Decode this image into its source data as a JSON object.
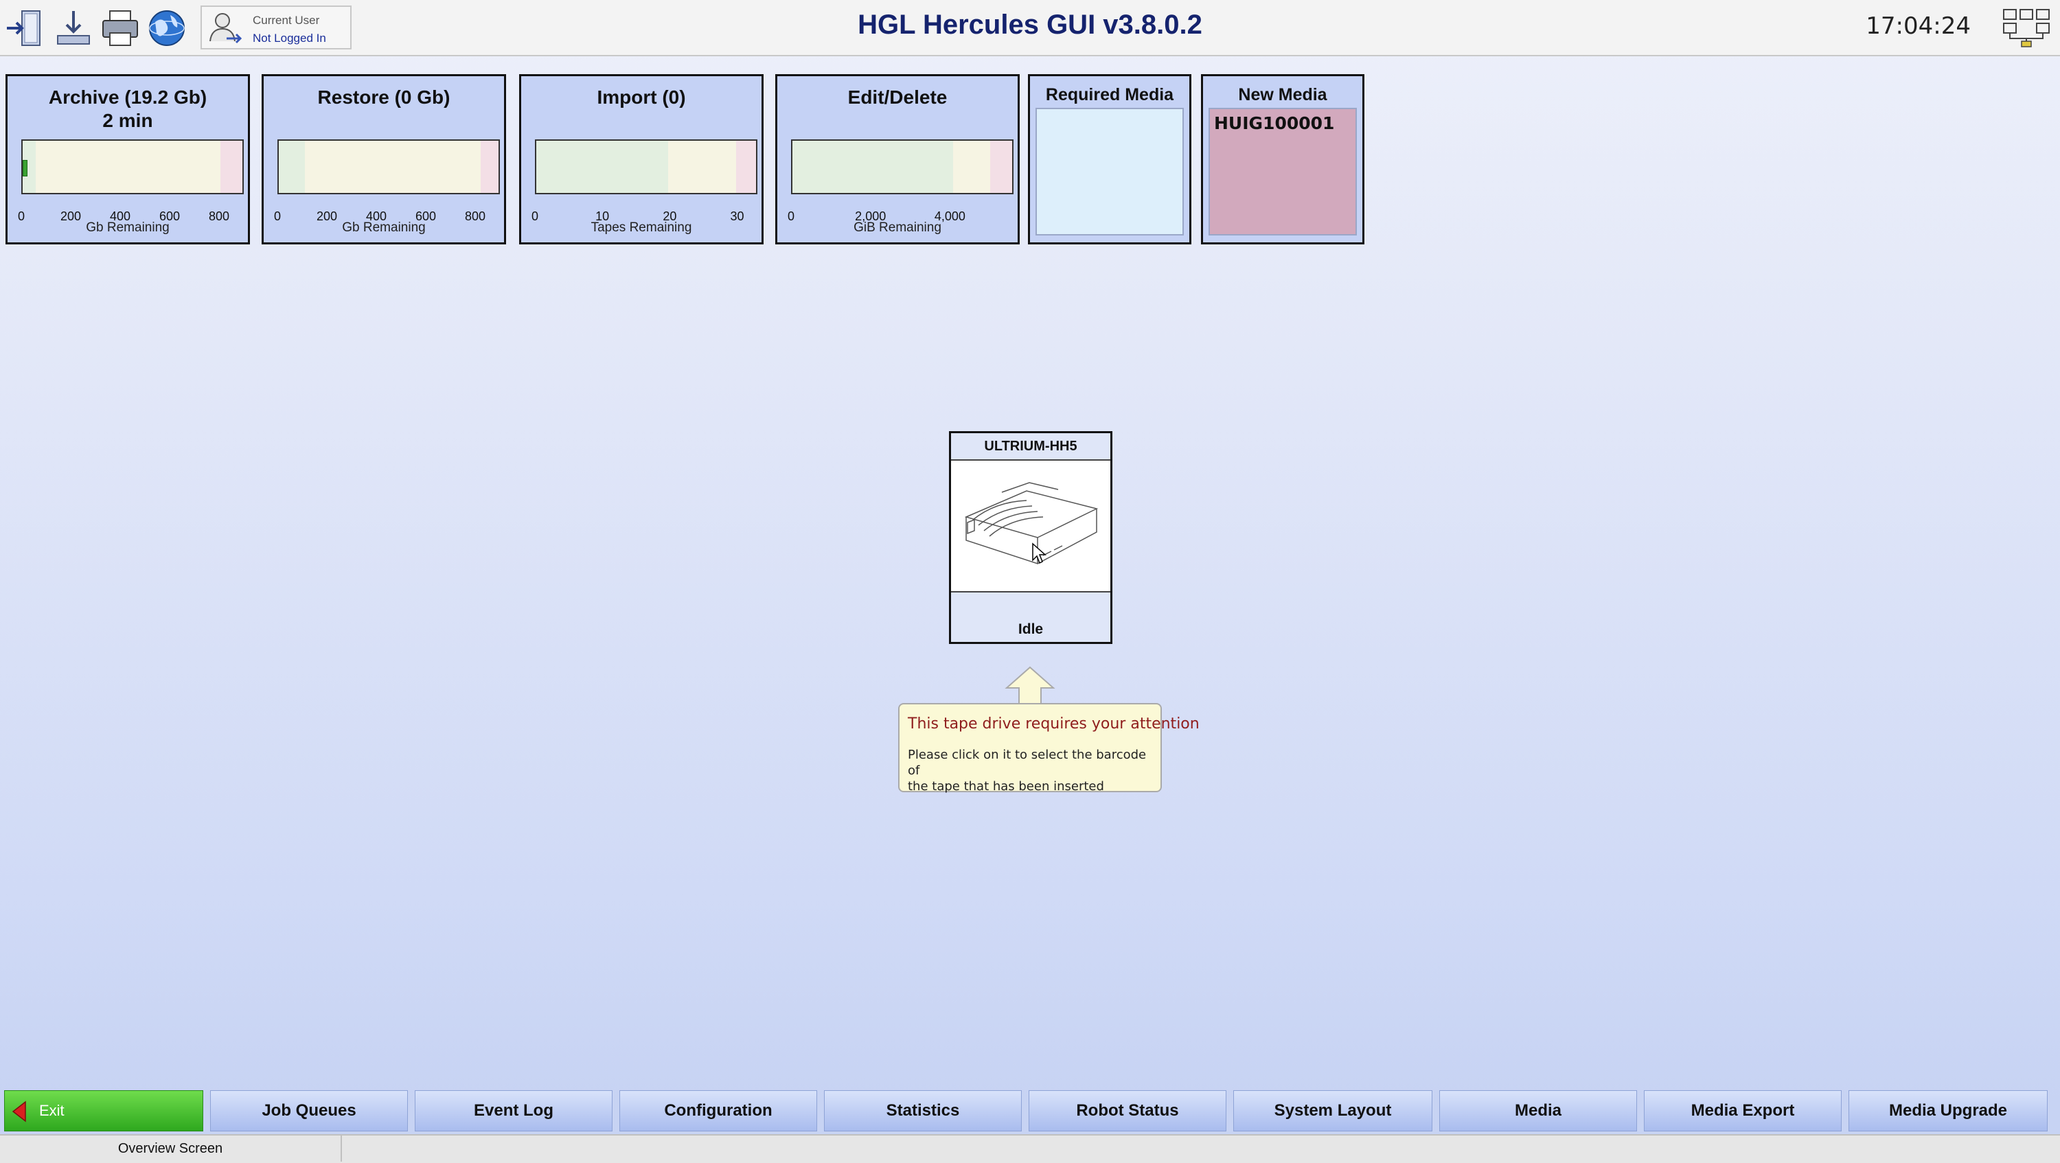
{
  "toolbar": {
    "icons": [
      "logout-icon",
      "download-icon",
      "printer-icon",
      "globe-icon"
    ],
    "user_label": "Current User",
    "user_value": "Not Logged In"
  },
  "app": {
    "title": "HGL Hercules GUI v3.8.0.2",
    "clock": "17:04:24"
  },
  "panels": {
    "archive": {
      "title": "Archive (19.2 Gb)",
      "subtitle": "2 min",
      "ticks": [
        "0",
        "200",
        "400",
        "600",
        "800"
      ],
      "label": "Gb Remaining",
      "level": 19.2,
      "max": 900
    },
    "restore": {
      "title": "Restore (0 Gb)",
      "ticks": [
        "0",
        "200",
        "400",
        "600",
        "800"
      ],
      "label": "Gb Remaining",
      "level": 0,
      "max": 900
    },
    "import": {
      "title": "Import (0)",
      "ticks": [
        "0",
        "10",
        "20",
        "30"
      ],
      "label": "Tapes Remaining",
      "level": 0,
      "max": 33
    },
    "edit_delete": {
      "title": "Edit/Delete",
      "ticks": [
        "0",
        "2,000",
        "4,000"
      ],
      "label": "GiB Remaining",
      "level": 0,
      "max": 5600
    },
    "required_media": {
      "title": "Required Media",
      "items": []
    },
    "new_media": {
      "title": "New Media",
      "items": [
        "HUIG100001"
      ]
    }
  },
  "drive": {
    "name": "ULTRIUM-HH5",
    "status": "Idle"
  },
  "callout": {
    "title": "This tape drive requires your attention",
    "line1": "Please click on it to select the barcode of",
    "line2": "the tape that has been inserted"
  },
  "nav": {
    "exit": "Exit",
    "buttons": [
      "Job Queues",
      "Event Log",
      "Configuration",
      "Statistics",
      "Robot Status",
      "System Layout",
      "Media",
      "Media Export",
      "Media Upgrade"
    ]
  },
  "status": {
    "screen": "Overview Screen"
  },
  "colors": {
    "title": "#15236e",
    "new_media_bg": "#d2a9bd",
    "required_media_bg": "#ddeffb",
    "exit_green": "#3db82a"
  }
}
